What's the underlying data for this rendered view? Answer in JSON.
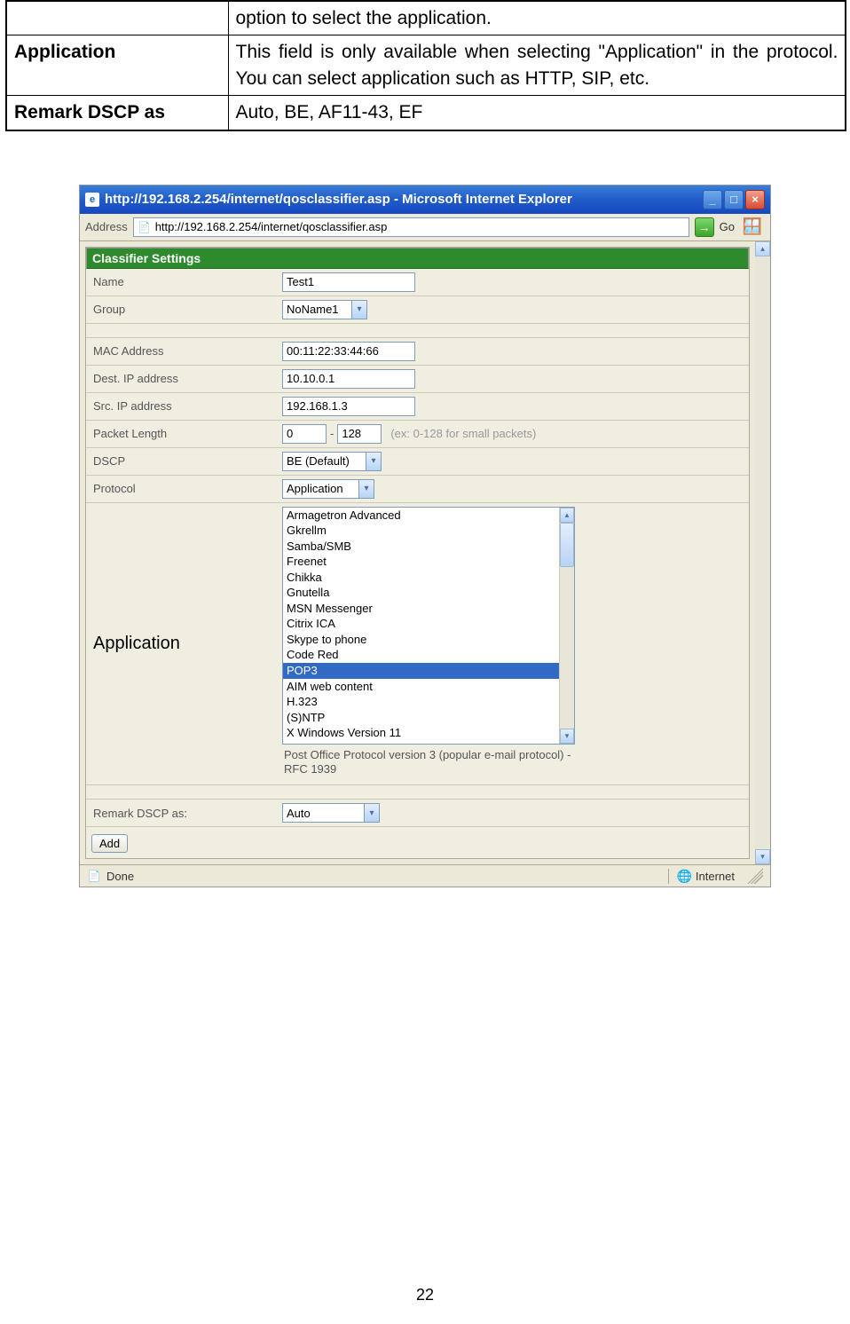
{
  "doc_table": {
    "row0_desc": "option to select the application.",
    "row1_label": "Application",
    "row1_desc": "This field is only available when selecting \"Application\" in the protocol. You can select application such as HTTP, SIP, etc.",
    "row2_label": "Remark DSCP as",
    "row2_desc": "Auto, BE, AF11-43, EF"
  },
  "window": {
    "title": "http://192.168.2.254/internet/qosclassifier.asp - Microsoft Internet Explorer",
    "address_label": "Address",
    "url": "http://192.168.2.254/internet/qosclassifier.asp",
    "go_label": "Go"
  },
  "form": {
    "section_title": "Classifier Settings",
    "name_label": "Name",
    "name_value": "Test1",
    "group_label": "Group",
    "group_value": "NoName1",
    "mac_label": "MAC Address",
    "mac_value": "00:11:22:33:44:66",
    "destip_label": "Dest. IP address",
    "destip_value": "10.10.0.1",
    "srcip_label": "Src. IP address",
    "srcip_value": "192.168.1.3",
    "pktlen_label": "Packet Length",
    "pktlen_from": "0",
    "pktlen_to": "128",
    "pktlen_hint": "(ex: 0-128 for small packets)",
    "dscp_label": "DSCP",
    "dscp_value": "BE (Default)",
    "proto_label": "Protocol",
    "proto_value": "Application",
    "app_label": "Application",
    "app_items": [
      "Armagetron Advanced",
      "Gkrellm",
      "Samba/SMB",
      "Freenet",
      "Chikka",
      "Gnutella",
      "MSN Messenger",
      "Citrix ICA",
      "Skype to phone",
      "Code Red",
      "POP3",
      "AIM web content",
      "H.323",
      "(S)NTP",
      "X Windows Version 11"
    ],
    "app_selected_index": 10,
    "app_desc": "Post Office Protocol version 3 (popular e-mail protocol) - RFC 1939",
    "remark_label": "Remark DSCP as:",
    "remark_value": "Auto",
    "add_button": "Add"
  },
  "status": {
    "done": "Done",
    "zone": "Internet"
  },
  "page_number": "22"
}
